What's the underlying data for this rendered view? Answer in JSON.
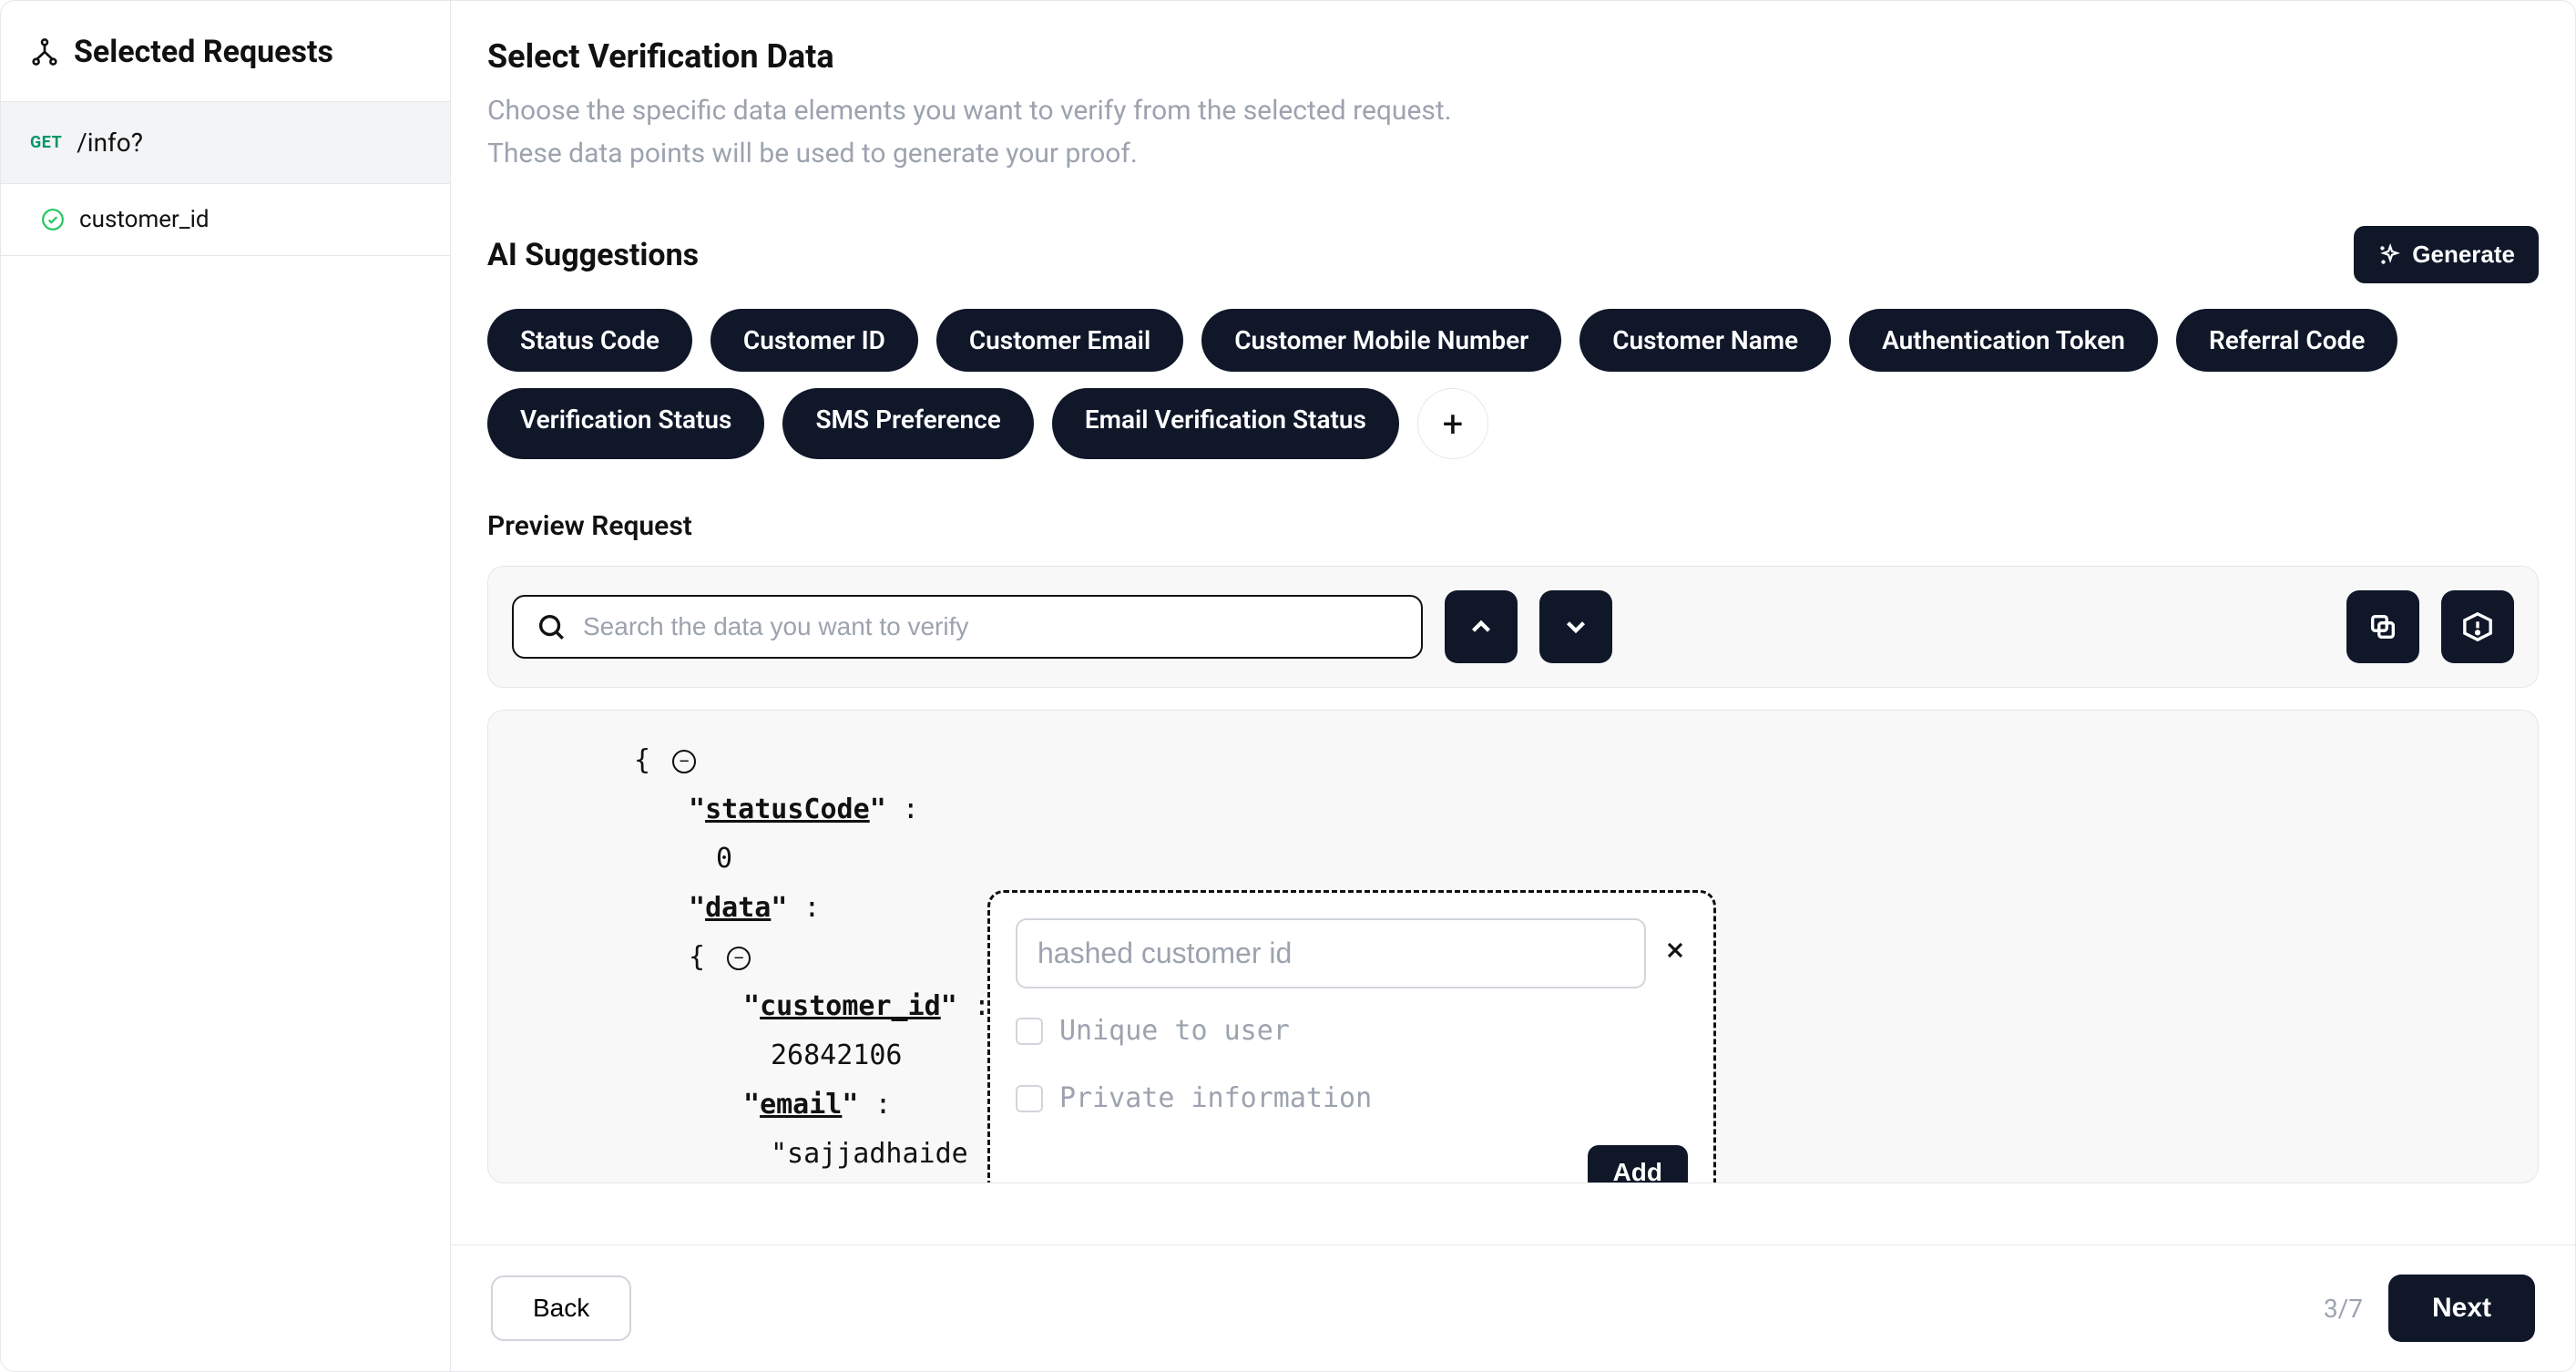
{
  "sidebar": {
    "title": "Selected Requests",
    "request": {
      "method": "GET",
      "path": "/info?"
    },
    "selected_field": "customer_id"
  },
  "header": {
    "title": "Select Verification Data",
    "subtitle_line1": "Choose the specific data elements you want to verify from the selected request.",
    "subtitle_line2": "These data points will be used to generate your proof."
  },
  "suggestions": {
    "title": "AI Suggestions",
    "generate_label": "Generate",
    "chips": [
      "Status Code",
      "Customer ID",
      "Customer Email",
      "Customer Mobile Number",
      "Customer Name",
      "Authentication Token",
      "Referral Code",
      "Verification Status",
      "SMS Preference",
      "Email Verification Status"
    ]
  },
  "preview": {
    "title": "Preview Request",
    "search_placeholder": "Search the data you want to verify",
    "json": {
      "key_statusCode": "statusCode",
      "val_statusCode": "0",
      "key_data": "data",
      "key_customer_id": "customer_id",
      "val_customer_id": "26842106",
      "key_email": "email",
      "val_email": "\"sajjadhaide"
    }
  },
  "popover": {
    "input_value": "hashed customer id",
    "unique_label": "Unique to user",
    "private_label": "Private information",
    "add_label": "Add"
  },
  "footer": {
    "back_label": "Back",
    "step": "3/7",
    "next_label": "Next"
  }
}
